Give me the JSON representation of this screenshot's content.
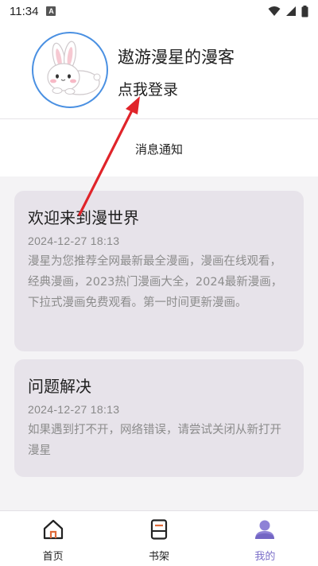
{
  "status_bar": {
    "time": "11:34",
    "notification_icon": "a-badge-icon",
    "icons": [
      "wifi-icon",
      "signal-icon",
      "battery-icon"
    ]
  },
  "profile": {
    "nickname": "遨游漫星的漫客",
    "login_text": "点我登录",
    "avatar_icon": "bunny-avatar-icon"
  },
  "messages": {
    "section_title": "消息通知",
    "items": [
      {
        "title": "欢迎来到漫世界",
        "date": "2024-12-27 18:13",
        "body": "漫星为您推荐全网最新最全漫画，漫画在线观看，经典漫画，2023热门漫画大全，2024最新漫画，下拉式漫画免费观看。第一时间更新漫画。"
      },
      {
        "title": "问题解决",
        "date": "2024-12-27 18:13",
        "body": "如果遇到打不开，网络错误，请尝试关闭从新打开漫星"
      }
    ]
  },
  "bottom_nav": {
    "items": [
      {
        "label": "首页",
        "icon": "home-icon"
      },
      {
        "label": "书架",
        "icon": "bookshelf-icon"
      },
      {
        "label": "我的",
        "icon": "profile-icon"
      }
    ],
    "active_index": 2
  },
  "colors": {
    "accent": "#7b6fc9",
    "card_bg": "#e7e3ea",
    "avatar_border": "#4a90e2",
    "annotation_arrow": "#e0242a"
  }
}
